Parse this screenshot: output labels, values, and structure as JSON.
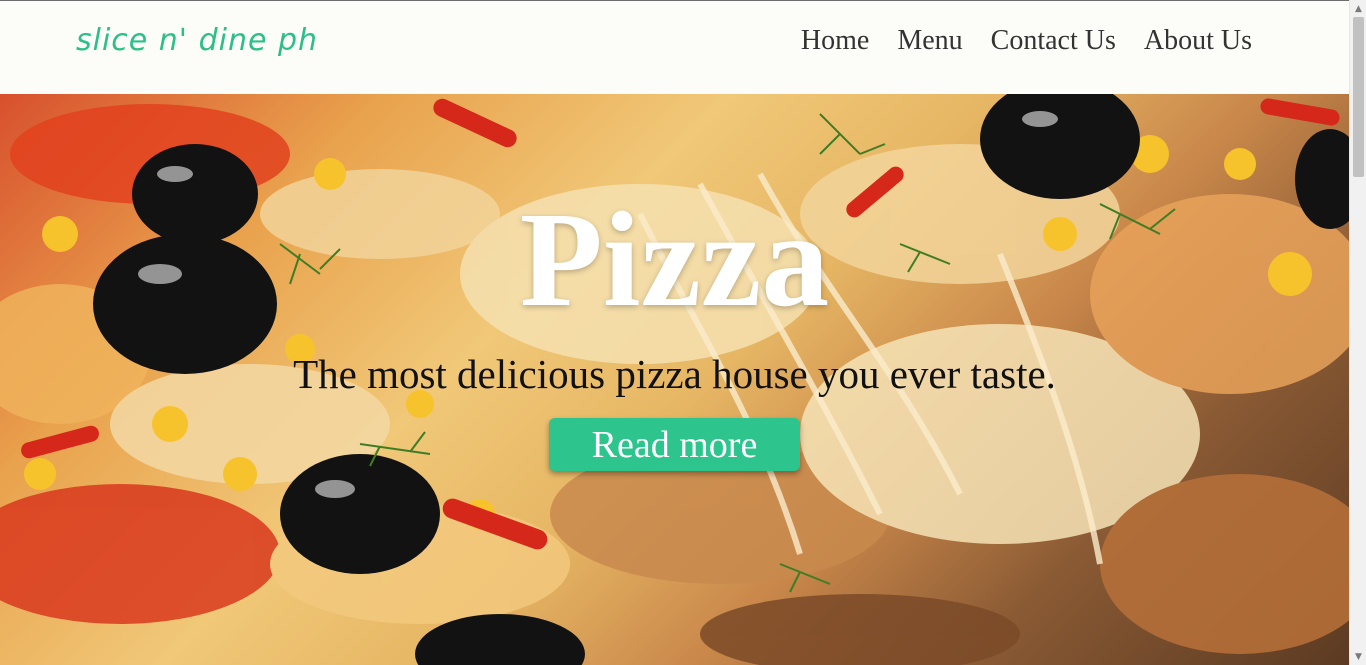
{
  "header": {
    "logo": "slice n' dine ph",
    "nav": [
      "Home",
      "Menu",
      "Contact Us",
      "About Us"
    ]
  },
  "hero": {
    "title": "Pizza",
    "subtitle": "The most delicious pizza house you ever taste.",
    "cta_label": "Read more",
    "image": "pizza-photo"
  },
  "colors": {
    "accent": "#2dc48d",
    "logo": "#2cbf8a",
    "nav_text": "#333333",
    "header_bg": "#fcfcf8"
  },
  "icons": {
    "scroll_up": "scroll-up-arrow-icon",
    "scroll_down": "scroll-down-arrow-icon"
  }
}
